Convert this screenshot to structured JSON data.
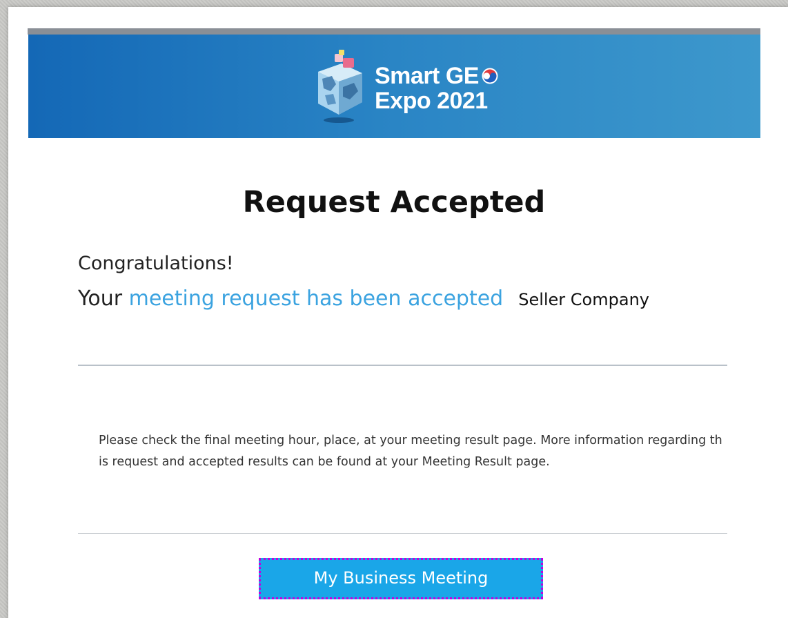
{
  "banner": {
    "logo_line1": "Smart GE",
    "logo_line2": "Expo 2021"
  },
  "main": {
    "title": "Request Accepted",
    "congratulations": "Congratulations!",
    "your": "Your",
    "highlight": "meeting request has been accepted",
    "company": "Seller Company",
    "info": "Please check the final meeting hour, place, at your meeting result page. More information regarding this request and accepted results can be found at your Meeting Result page."
  },
  "actions": {
    "my_business_meeting": "My Business Meeting"
  },
  "colors": {
    "banner_start": "#1468b6",
    "banner_end": "#3d98cc",
    "highlight": "#3ba3e0",
    "button": "#1aa6e8"
  }
}
